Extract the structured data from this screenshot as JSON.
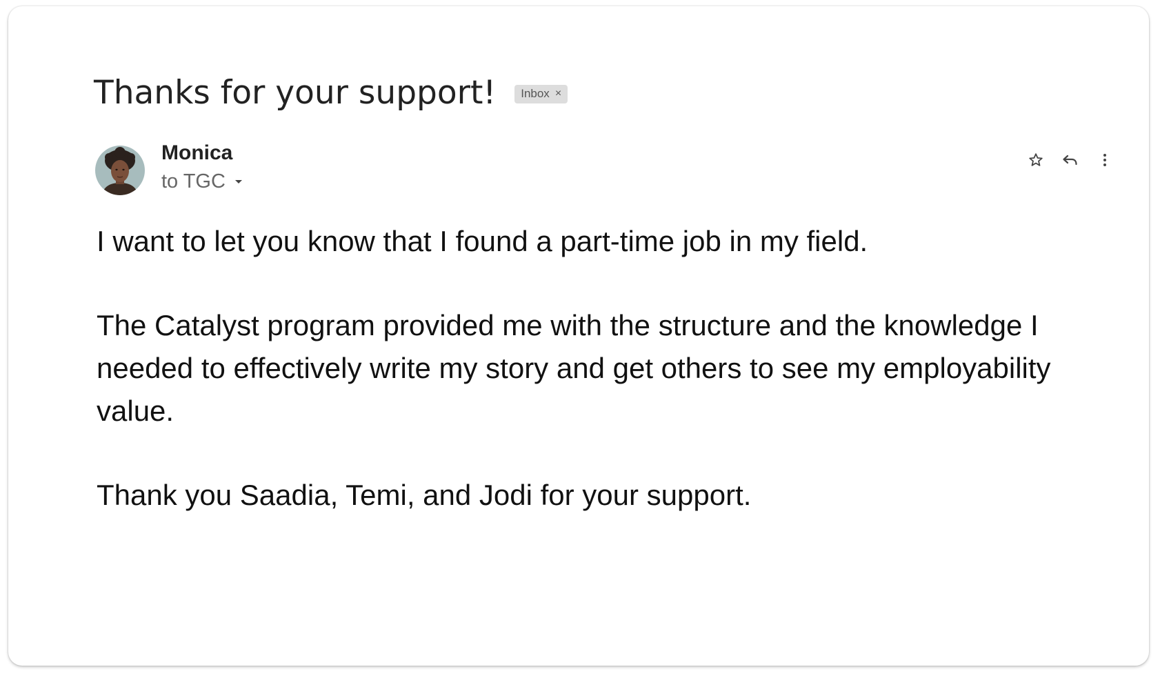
{
  "email": {
    "subject": "Thanks for your support!",
    "label": "Inbox",
    "label_close": "×",
    "sender": {
      "name": "Monica",
      "recipient": "to TGC"
    },
    "actions": [
      {
        "name": "star",
        "icon": "star-icon"
      },
      {
        "name": "reply",
        "icon": "reply-icon"
      },
      {
        "name": "more",
        "icon": "more-vert-icon"
      }
    ],
    "body": {
      "p1": "I want to let you know that I found a part-time job in my field.",
      "p2": "The Catalyst program provided me with the structure and the knowledge I needed to effectively write my story and get others to see my employability value.",
      "p3": "Thank you Saadia, Temi, and Jodi for your support."
    }
  },
  "colors": {
    "subject": "#222222",
    "chip_bg": "#dddddd",
    "recipient": "#666666",
    "body": "#111111"
  }
}
